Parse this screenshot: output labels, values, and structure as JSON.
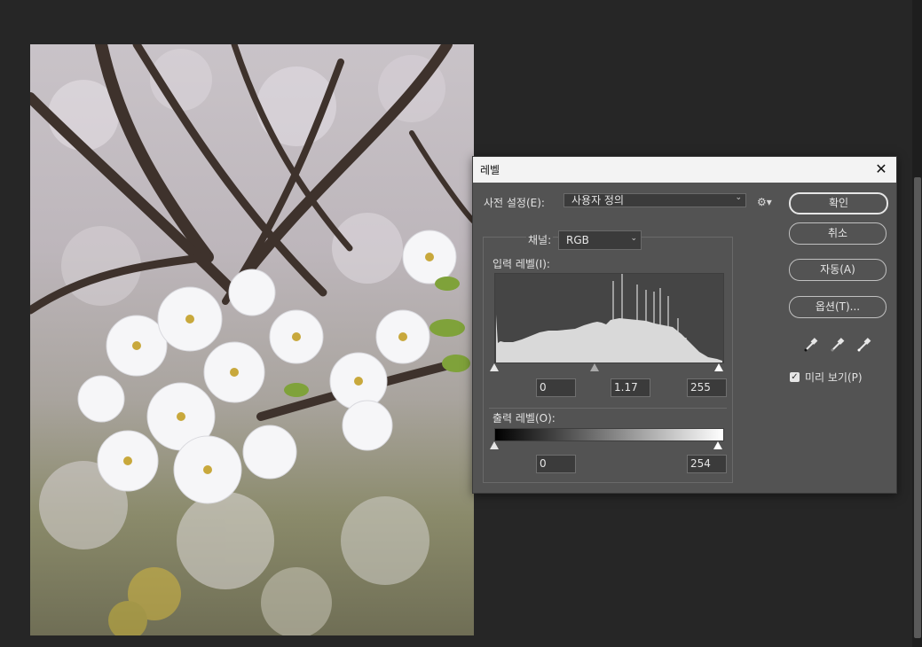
{
  "dialog": {
    "title": "레벨",
    "preset_label": "사전 설정(E):",
    "preset_value": "사용자 정의",
    "channel_label": "채널:",
    "channel_value": "RGB",
    "input_levels_label": "입력 레벨(I):",
    "input_black": "0",
    "input_gamma": "1.17",
    "input_white": "255",
    "output_levels_label": "출력 레벨(O):",
    "output_black": "0",
    "output_white": "254",
    "buttons": {
      "ok": "확인",
      "cancel": "취소",
      "auto": "자동(A)",
      "options": "옵션(T)..."
    },
    "preview_label": "미리 보기(P)",
    "preview_checked": true
  },
  "icons": {
    "close": "close-icon",
    "settings": "gear-icon",
    "black_eyedropper": "eyedropper-black-icon",
    "gray_eyedropper": "eyedropper-gray-icon",
    "white_eyedropper": "eyedropper-white-icon"
  },
  "colors": {
    "workspace": "#262626",
    "dialog_bg": "#535353",
    "histogram_fill": "#d9d9d9"
  }
}
